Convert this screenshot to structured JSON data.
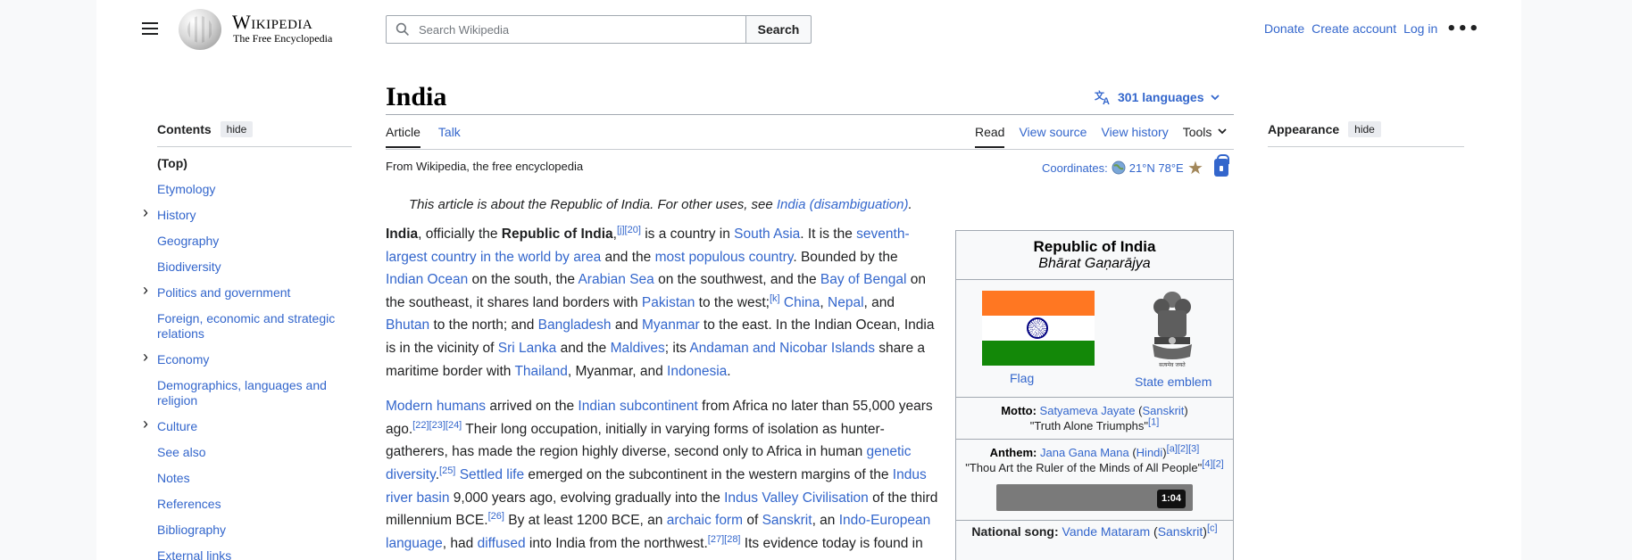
{
  "header": {
    "wordmark": "Wikipedia",
    "tagline": "The Free Encyclopedia",
    "search_placeholder": "Search Wikipedia",
    "search_button": "Search",
    "user_links": [
      "Donate",
      "Create account",
      "Log in"
    ],
    "more": "•••"
  },
  "toc": {
    "title": "Contents",
    "hide": "hide",
    "items": [
      {
        "label": "(Top)",
        "expandable": false
      },
      {
        "label": "Etymology",
        "expandable": false
      },
      {
        "label": "History",
        "expandable": true
      },
      {
        "label": "Geography",
        "expandable": false
      },
      {
        "label": "Biodiversity",
        "expandable": false
      },
      {
        "label": "Politics and government",
        "expandable": true
      },
      {
        "label": "Foreign, economic and strategic relations",
        "expandable": false
      },
      {
        "label": "Economy",
        "expandable": true
      },
      {
        "label": "Demographics, languages and religion",
        "expandable": false
      },
      {
        "label": "Culture",
        "expandable": true
      },
      {
        "label": "See also",
        "expandable": false
      },
      {
        "label": "Notes",
        "expandable": false
      },
      {
        "label": "References",
        "expandable": false
      },
      {
        "label": "Bibliography",
        "expandable": false
      },
      {
        "label": "External links",
        "expandable": false
      }
    ]
  },
  "article": {
    "title": "India",
    "languages": "301 languages",
    "tabs_left": [
      "Article",
      "Talk"
    ],
    "tabs_right": [
      "Read",
      "View source",
      "View history",
      "Tools"
    ],
    "tagline": "From Wikipedia, the free encyclopedia",
    "coordinates_label": "Coordinates:",
    "coordinates_value": "21°N 78°E",
    "hatnote_text": "This article is about the Republic of India. For other uses, see ",
    "hatnote_link": "India (disambiguation)",
    "hatnote_end": "."
  },
  "infobox": {
    "title": "Republic of India",
    "native": "Bhārat Gaṇarājya",
    "flag_caption": "Flag",
    "emblem_caption": "State emblem",
    "motto_label": "Motto:",
    "motto_value": "Satyameva Jayate",
    "motto_lang": "Sanskrit",
    "motto_translation": "\"Truth Alone Triumphs\"",
    "motto_refs": "[1]",
    "anthem_label": "Anthem:",
    "anthem_value": "Jana Gana Mana",
    "anthem_lang": "Hindi",
    "anthem_refs": "[a][2][3]",
    "anthem_translation": "\"Thou Art the Ruler of the Minds of All People\"",
    "anthem_translation_refs": "[4][2]",
    "audio_duration": "1:04",
    "song_label": "National song:",
    "song_value": "Vande Mataram",
    "song_lang": "Sanskrit",
    "song_refs": "[c]"
  },
  "appearance": {
    "title": "Appearance",
    "hide": "hide"
  },
  "colors": {
    "link": "#3366cc",
    "saffron": "#ff7722",
    "green": "#138808",
    "navy": "#000080"
  }
}
